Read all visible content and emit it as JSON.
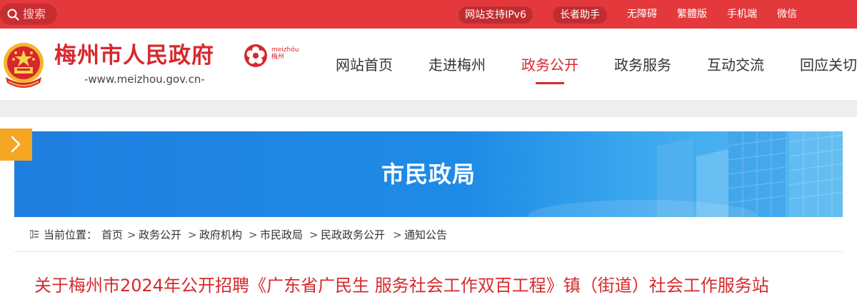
{
  "topbar": {
    "search_placeholder": "搜索",
    "links": [
      "网站支持IPv6",
      "长者助手",
      "无障碍",
      "繁體版",
      "手机端",
      "微信"
    ]
  },
  "header": {
    "site_name": "梅州市人民政府",
    "domain": "-www.meizhou.gov.cn-",
    "logo_text_pinyin": "meizhōu",
    "logo_text_cn": "梅州",
    "nav": [
      "网站首页",
      "走进梅州",
      "政务公开",
      "政务服务",
      "互动交流",
      "回应关切"
    ],
    "active_nav": "政务公开"
  },
  "banner": {
    "title": "市民政局"
  },
  "breadcrumb": {
    "label": "当前位置：",
    "items": [
      "首页",
      "政务公开",
      "政府机构",
      "市民政局",
      "民政政务公开",
      "通知公告"
    ],
    "separator": ">"
  },
  "article": {
    "title_partial": "关于梅州市2024年公开招聘《广东省广民生 服务社会工作双百工程》镇（街道）社会工作服务站"
  },
  "colors": {
    "brand_red": "#e3393c",
    "title_red": "#d7282d",
    "banner_blue": "#1f87e4",
    "toggle_orange": "#f5a623"
  }
}
